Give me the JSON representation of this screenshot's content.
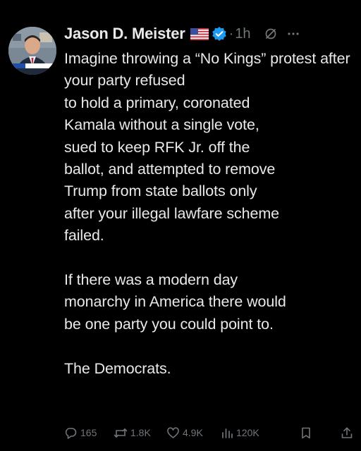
{
  "post": {
    "author_name": "Jason D. Meister",
    "flag_icon": "us-flag-icon",
    "verified_icon": "verified-badge-icon",
    "separator": "·",
    "timestamp": "1h",
    "paragraphs": [
      "Imagine throwing a “No Kings” protest after your party refused to hold a primary, coronated Kamala without a single vote, sued to keep RFK Jr. off the ballot, and attempted to remove Trump from state ballots only after your illegal lawfare scheme failed.",
      "If there was a modern day monarchy in America there would be one party you could point to.",
      "The Democrats."
    ],
    "text": "Imagine throwing a “No Kings” protest after your party refused\nto hold a primary, coronated\nKamala without a single vote,\nsued to keep RFK Jr. off the\nballot, and attempted to remove\nTrump from state ballots only\nafter your illegal lawfare scheme\nfailed.\n\nIf there was a modern day\nmonarchy in America there would\nbe one party you could point to.\n\nThe Democrats."
  },
  "actions": {
    "replies": "165",
    "reposts": "1.8K",
    "likes": "4.9K",
    "views": "120K"
  },
  "colors": {
    "background": "#000000",
    "text": "#e7e9ea",
    "secondary": "#71767b",
    "verified": "#1d9bf0"
  }
}
